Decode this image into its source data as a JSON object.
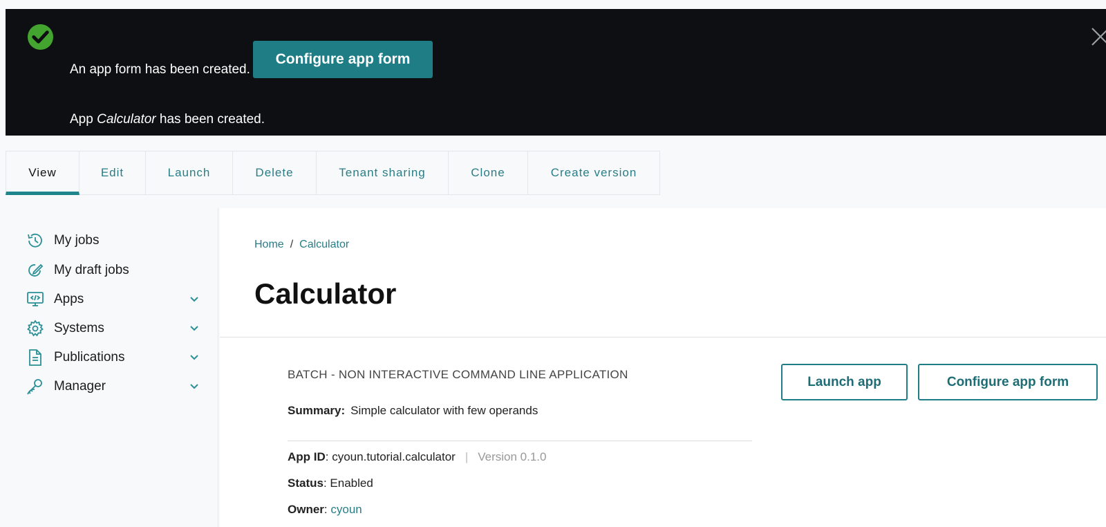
{
  "banner": {
    "message1": "An app form has been created.",
    "configure_label": "Configure app form",
    "message2_prefix": "App ",
    "message2_app": "Calculator",
    "message2_suffix": " has been created.",
    "icon": "check-circle-icon",
    "success_color": "#43a42f"
  },
  "tabs": [
    {
      "label": "View",
      "active": true
    },
    {
      "label": "Edit"
    },
    {
      "label": "Launch"
    },
    {
      "label": "Delete"
    },
    {
      "label": "Tenant sharing"
    },
    {
      "label": "Clone"
    },
    {
      "label": "Create version"
    }
  ],
  "sidebar": {
    "items": [
      {
        "label": "My jobs",
        "icon": "history-icon"
      },
      {
        "label": "My draft jobs",
        "icon": "draft-edit-icon"
      },
      {
        "label": "Apps",
        "icon": "code-monitor-icon",
        "expandable": true
      },
      {
        "label": "Systems",
        "icon": "gear-icon",
        "expandable": true
      },
      {
        "label": "Publications",
        "icon": "document-icon",
        "expandable": true
      },
      {
        "label": "Manager",
        "icon": "key-user-icon",
        "expandable": true
      }
    ]
  },
  "breadcrumb": {
    "home": "Home",
    "separator": "/",
    "current": "Calculator"
  },
  "page": {
    "title": "Calculator",
    "app_type": "BATCH - NON INTERACTIVE COMMAND LINE APPLICATION",
    "summary_label": "Summary:",
    "summary_value": "Simple calculator with few operands",
    "app_id_label": "App ID",
    "app_id_value": ": cyoun.tutorial.calculator",
    "pipe": "|",
    "version": "Version 0.1.0",
    "status_label": "Status",
    "status_value": ": Enabled",
    "owner_label": "Owner",
    "owner_sep": ": ",
    "owner_value": "cyoun",
    "launch_label": "Launch app",
    "configure_label": "Configure app form"
  },
  "colors": {
    "accent": "#1e7d85",
    "banner_bg": "#0d0f12",
    "link": "#2a7d86"
  }
}
